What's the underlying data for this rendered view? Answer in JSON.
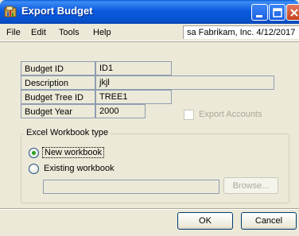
{
  "window": {
    "title": "Export Budget"
  },
  "menu": {
    "items": [
      {
        "label": "File"
      },
      {
        "label": "Edit"
      },
      {
        "label": "Tools"
      },
      {
        "label": "Help"
      }
    ],
    "system_info": "sa  Fabrikam, Inc.  4/12/2017"
  },
  "form": {
    "budget_id_label": "Budget ID",
    "budget_id_value": "ID1",
    "description_label": "Description",
    "description_value": "jkjl",
    "budget_tree_id_label": "Budget Tree ID",
    "budget_tree_id_value": "TREE1",
    "budget_year_label": "Budget Year",
    "budget_year_value": "2000",
    "export_accounts_label": "Export Accounts",
    "export_accounts_checked": false
  },
  "workbook": {
    "group_title": "Excel Workbook type",
    "new_workbook_label": "New workbook",
    "existing_workbook_label": "Existing workbook",
    "selected": "new",
    "path_value": "",
    "browse_label": "Browse..."
  },
  "buttons": {
    "ok_label": "OK",
    "cancel_label": "Cancel"
  },
  "colors": {
    "titlebar": "#0b5be0",
    "dialog_bg": "#ece9d8",
    "radio_selected": "#21a121"
  }
}
